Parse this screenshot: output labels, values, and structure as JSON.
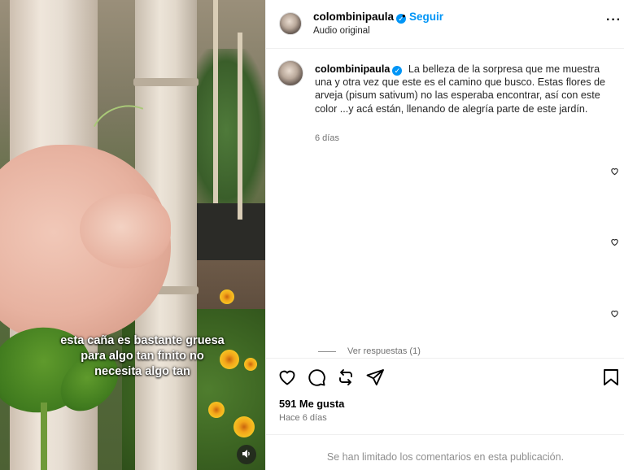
{
  "media": {
    "caption_lines": [
      "esta caña es bastante gruesa",
      "para algo tan finito no",
      "necesita algo tan"
    ],
    "sound_icon": "volume-icon"
  },
  "header": {
    "username": "colombinipaula",
    "separator": "•",
    "follow_label": "Seguir",
    "audio_label": "Audio original",
    "more_icon": "more-options-icon"
  },
  "post_caption": {
    "username": "colombinipaula",
    "text": "La belleza de la sorpresa que me muestra una y otra vez que este es el camino que busco. Estas flores de arveja (pisum sativum) no las esperaba encontrar, así con este color ...y acá están, llenando de alegría parte de este jardín.",
    "time": "6 días"
  },
  "comments": {
    "view_replies": "Ver respuestas (1)"
  },
  "actions": {
    "likes": "591 Me gusta",
    "posted_ago": "Hace 6 días"
  },
  "footer": {
    "limited_text": "Se han limitado los comentarios en esta publicación."
  },
  "colors": {
    "accent": "#0095f6",
    "muted": "#737373"
  }
}
